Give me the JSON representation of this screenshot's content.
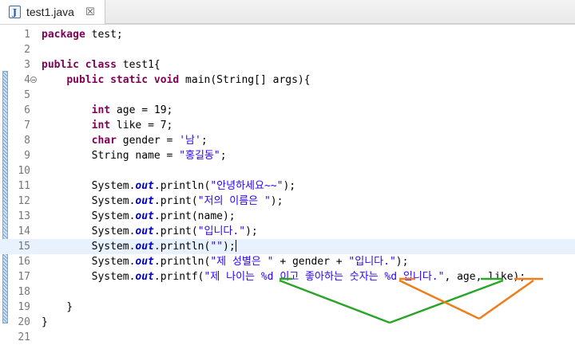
{
  "tab": {
    "title": "test1.java",
    "icon": "java-file-icon",
    "close_symbol": "☒"
  },
  "editor": {
    "current_line": 15,
    "lines": [
      {
        "num": "1",
        "code": "package test;"
      },
      {
        "num": "2",
        "code": ""
      },
      {
        "num": "3",
        "code": "public class test1{"
      },
      {
        "num": "4",
        "code": "    public static void main(String[] args){"
      },
      {
        "num": "5",
        "code": ""
      },
      {
        "num": "6",
        "code": "        int age = 19;"
      },
      {
        "num": "7",
        "code": "        int like = 7;"
      },
      {
        "num": "8",
        "code": "        char gender = '남';"
      },
      {
        "num": "9",
        "code": "        String name = \"홍길동\";"
      },
      {
        "num": "10",
        "code": ""
      },
      {
        "num": "11",
        "code": "        System.out.println(\"안녕하세요~~\");"
      },
      {
        "num": "12",
        "code": "        System.out.print(\"저의 이름은 \");"
      },
      {
        "num": "13",
        "code": "        System.out.print(name);"
      },
      {
        "num": "14",
        "code": "        System.out.print(\"입니다.\");"
      },
      {
        "num": "15",
        "code": "        System.out.println(\"\");"
      },
      {
        "num": "16",
        "code": "        System.out.println(\"제 성별은 \" + gender + \"입니다.\");"
      },
      {
        "num": "17",
        "code": "        System.out.printf(\"제 나이는 %d 이고 좋아하는 숫자는 %d 입니다.\", age, like);"
      },
      {
        "num": "18",
        "code": ""
      },
      {
        "num": "19",
        "code": "    }"
      },
      {
        "num": "20",
        "code": "}"
      },
      {
        "num": "21",
        "code": ""
      }
    ]
  },
  "annotation_colors": {
    "green": "#2aa52a",
    "orange": "#f07d1a"
  },
  "quick_diff_color": "#6fa3d6"
}
